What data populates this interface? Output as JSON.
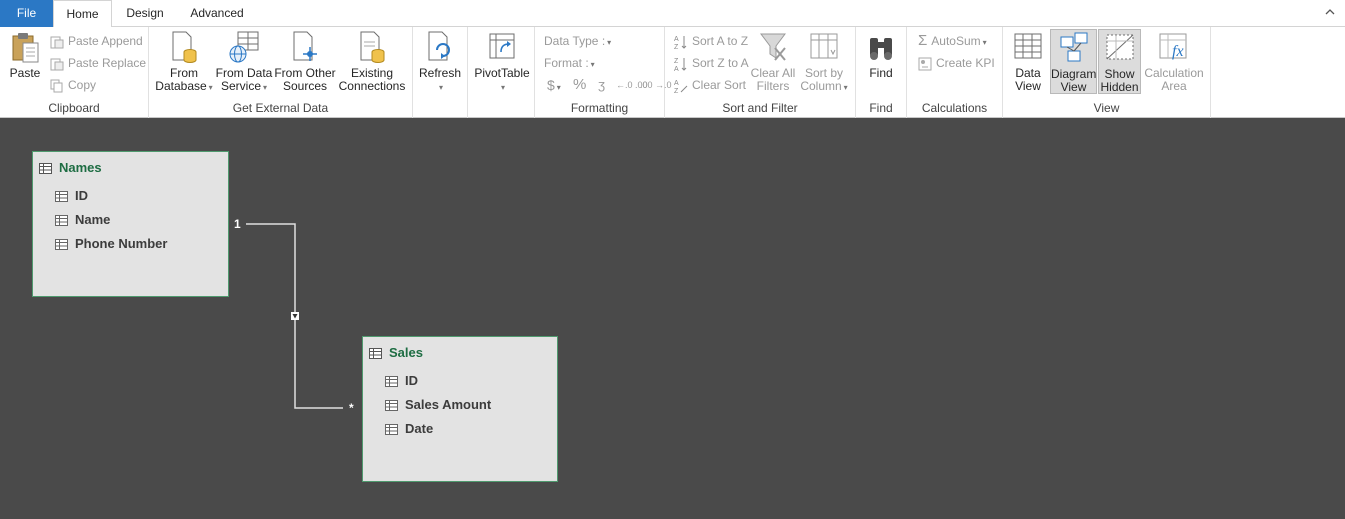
{
  "tabs": {
    "file": "File",
    "home": "Home",
    "design": "Design",
    "advanced": "Advanced"
  },
  "clipboard": {
    "paste": "Paste",
    "paste_append": "Paste Append",
    "paste_replace": "Paste Replace",
    "copy": "Copy",
    "label": "Clipboard"
  },
  "external": {
    "from_database_1": "From",
    "from_database_2": "Database",
    "from_data_service_1": "From Data",
    "from_data_service_2": "Service",
    "from_other_sources_1": "From Other",
    "from_other_sources_2": "Sources",
    "existing_connections_1": "Existing",
    "existing_connections_2": "Connections",
    "label": "Get External Data"
  },
  "refresh": {
    "label": "Refresh"
  },
  "pivot": {
    "label": "PivotTable"
  },
  "formatting": {
    "data_type": "Data Type :",
    "format": "Format :",
    "currency": "$",
    "percent": "%",
    "comma": "ʒ",
    "inc_decimal": "←.0 .00",
    "dec_decimal": ".00 →.0",
    "label": "Formatting"
  },
  "sort_filter": {
    "sort_a_z": "Sort A to Z",
    "sort_z_a": "Sort Z to A",
    "clear_sort": "Clear Sort",
    "clear_filters_1": "Clear All",
    "clear_filters_2": "Filters",
    "sort_by_col_1": "Sort by",
    "sort_by_col_2": "Column",
    "label": "Sort and Filter"
  },
  "find": {
    "button": "Find",
    "label": "Find"
  },
  "calculations": {
    "autosum": "AutoSum",
    "create_kpi": "Create KPI",
    "label": "Calculations"
  },
  "view": {
    "data_view_1": "Data",
    "data_view_2": "View",
    "diagram_view_1": "Diagram",
    "diagram_view_2": "View",
    "show_hidden_1": "Show",
    "show_hidden_2": "Hidden",
    "calc_area_1": "Calculation",
    "calc_area_2": "Area",
    "label": "View"
  },
  "diagram": {
    "names_table": {
      "title": "Names",
      "columns": [
        "ID",
        "Name",
        "Phone Number"
      ]
    },
    "sales_table": {
      "title": "Sales",
      "columns": [
        "ID",
        "Sales Amount",
        "Date"
      ]
    },
    "relationship": {
      "one_side": "1",
      "many_side": "*"
    }
  },
  "colors": {
    "file_tab": "#2b78c5",
    "canvas": "#4a4a4a",
    "table_header_text": "#1e6d43",
    "table_border": "#4f9a6e"
  }
}
